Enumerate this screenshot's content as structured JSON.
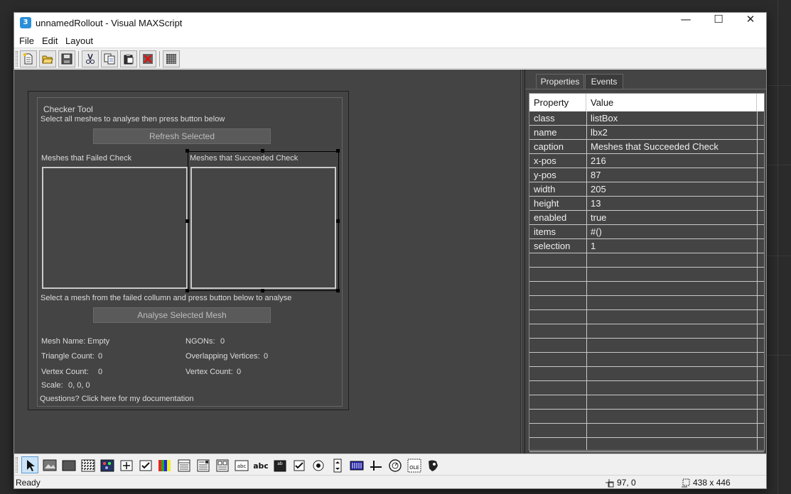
{
  "window": {
    "title": "unnamedRollout - Visual MAXScript",
    "app_icon_text": "3",
    "minimize_glyph": "—",
    "maximize_glyph": "☐",
    "close_glyph": "✕"
  },
  "menu": [
    "File",
    "Edit",
    "Layout"
  ],
  "toolbar": {
    "icons": [
      "new-file-icon",
      "open-folder-icon",
      "save-icon",
      "cut-icon",
      "copy-icon",
      "paste-icon",
      "delete-icon",
      "grid-icon"
    ]
  },
  "rollout": {
    "title": "Checker Tool",
    "instruction": "Select all meshes to analyse  then press button below",
    "refresh_button": "Refresh Selected",
    "failed_label": "Meshes that Failed Check",
    "succeeded_label": "Meshes that Succeeded Check",
    "analyse_instruction": "Select a mesh from the failed collumn and press button below to analyse",
    "analyse_button": "Analyse Selected Mesh",
    "mesh_name_label": "Mesh Name:",
    "mesh_name_value": "Empty",
    "ngons_label": "NGONs:",
    "ngons_value": "0",
    "triangle_label": "Triangle Count:",
    "triangle_value": "0",
    "overlap_label": "Overlapping Vertices:",
    "overlap_value": "0",
    "vertex_label": "Vertex Count:",
    "vertex_value": "0",
    "vertex2_label": "Vertex Count:",
    "vertex2_value": "0",
    "scale_label": "Scale:",
    "scale_value": "0, 0, 0",
    "doc_link": "Questions? Click here for my documentation"
  },
  "properties_panel": {
    "tabs": [
      "Properties",
      "Events"
    ],
    "headers": [
      "Property",
      "Value"
    ],
    "rows": [
      [
        "class",
        "listBox"
      ],
      [
        "name",
        "lbx2"
      ],
      [
        "caption",
        "Meshes that Succeeded Check"
      ],
      [
        "x-pos",
        "216"
      ],
      [
        "y-pos",
        "87"
      ],
      [
        "width",
        "205"
      ],
      [
        "height",
        "13"
      ],
      [
        "enabled",
        "true"
      ],
      [
        "items",
        "#()"
      ],
      [
        "selection",
        "1"
      ]
    ],
    "empty_rows": 14
  },
  "controls_toolbar": {
    "icons": [
      "pointer-tool-icon",
      "bitmap-control-icon",
      "button-control-icon",
      "map-button-icon",
      "material-button-icon",
      "pick-button-icon",
      "checkbutton-icon",
      "colorpicker-icon",
      "combobox-icon",
      "dropdownlist-icon",
      "listbox-icon",
      "edittext-icon",
      "label-icon",
      "groupbox-icon",
      "checkbox-icon",
      "radiobuttons-icon",
      "spinner-icon",
      "progressbar-icon",
      "slider-icon",
      "timer-icon",
      "activex-icon",
      "custom-control-icon"
    ],
    "label_abc": "abc",
    "label_ab": "ab",
    "label_ole": "OLE"
  },
  "status": {
    "text": "Ready",
    "position": "97, 0",
    "size": "438 x 446"
  }
}
